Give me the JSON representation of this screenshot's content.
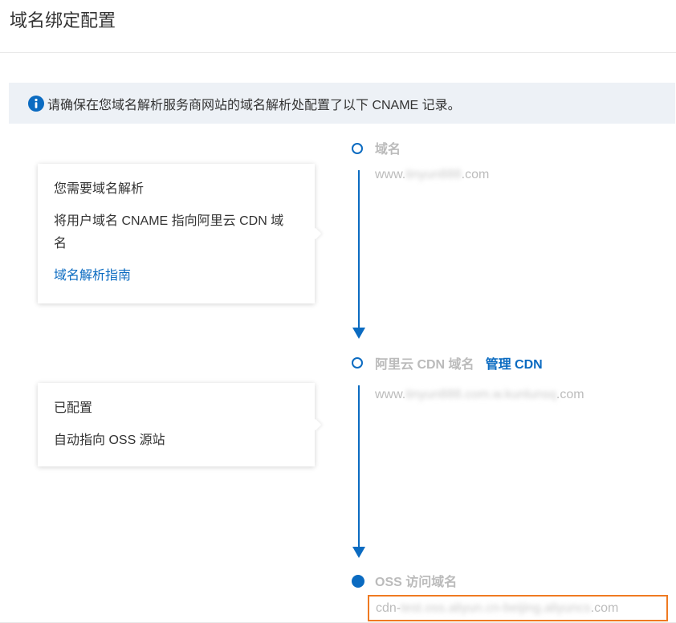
{
  "page": {
    "title": "域名绑定配置"
  },
  "notice": {
    "icon": "info-icon",
    "text": "请确保在您域名解析服务商网站的域名解析处配置了以下 CNAME 记录。"
  },
  "cards": [
    {
      "line1": "您需要域名解析",
      "line2": "将用户域名 CNAME 指向阿里云 CDN 域名",
      "link": "域名解析指南"
    },
    {
      "line1": "已配置",
      "line2": "自动指向 OSS 源站"
    }
  ],
  "steps": [
    {
      "title": "域名",
      "value_prefix": "www.",
      "value_blurred": "tinyun888",
      "value_suffix": ".com"
    },
    {
      "title": "阿里云 CDN 域名",
      "manage_link": "管理 CDN",
      "value_prefix": "www.",
      "value_blurred": "tinyun888.com.w.kunlunsq",
      "value_suffix": ".com"
    },
    {
      "title": "OSS 访问域名",
      "value_prefix": "cdn-",
      "value_blurred": "test.oss.aliyun.cn-beijing.aliyuncs",
      "value_suffix": ".com"
    }
  ],
  "colors": {
    "accent": "#0b6bc1",
    "highlight_border": "#ef7a22",
    "notice_bg": "#edf1f6"
  }
}
